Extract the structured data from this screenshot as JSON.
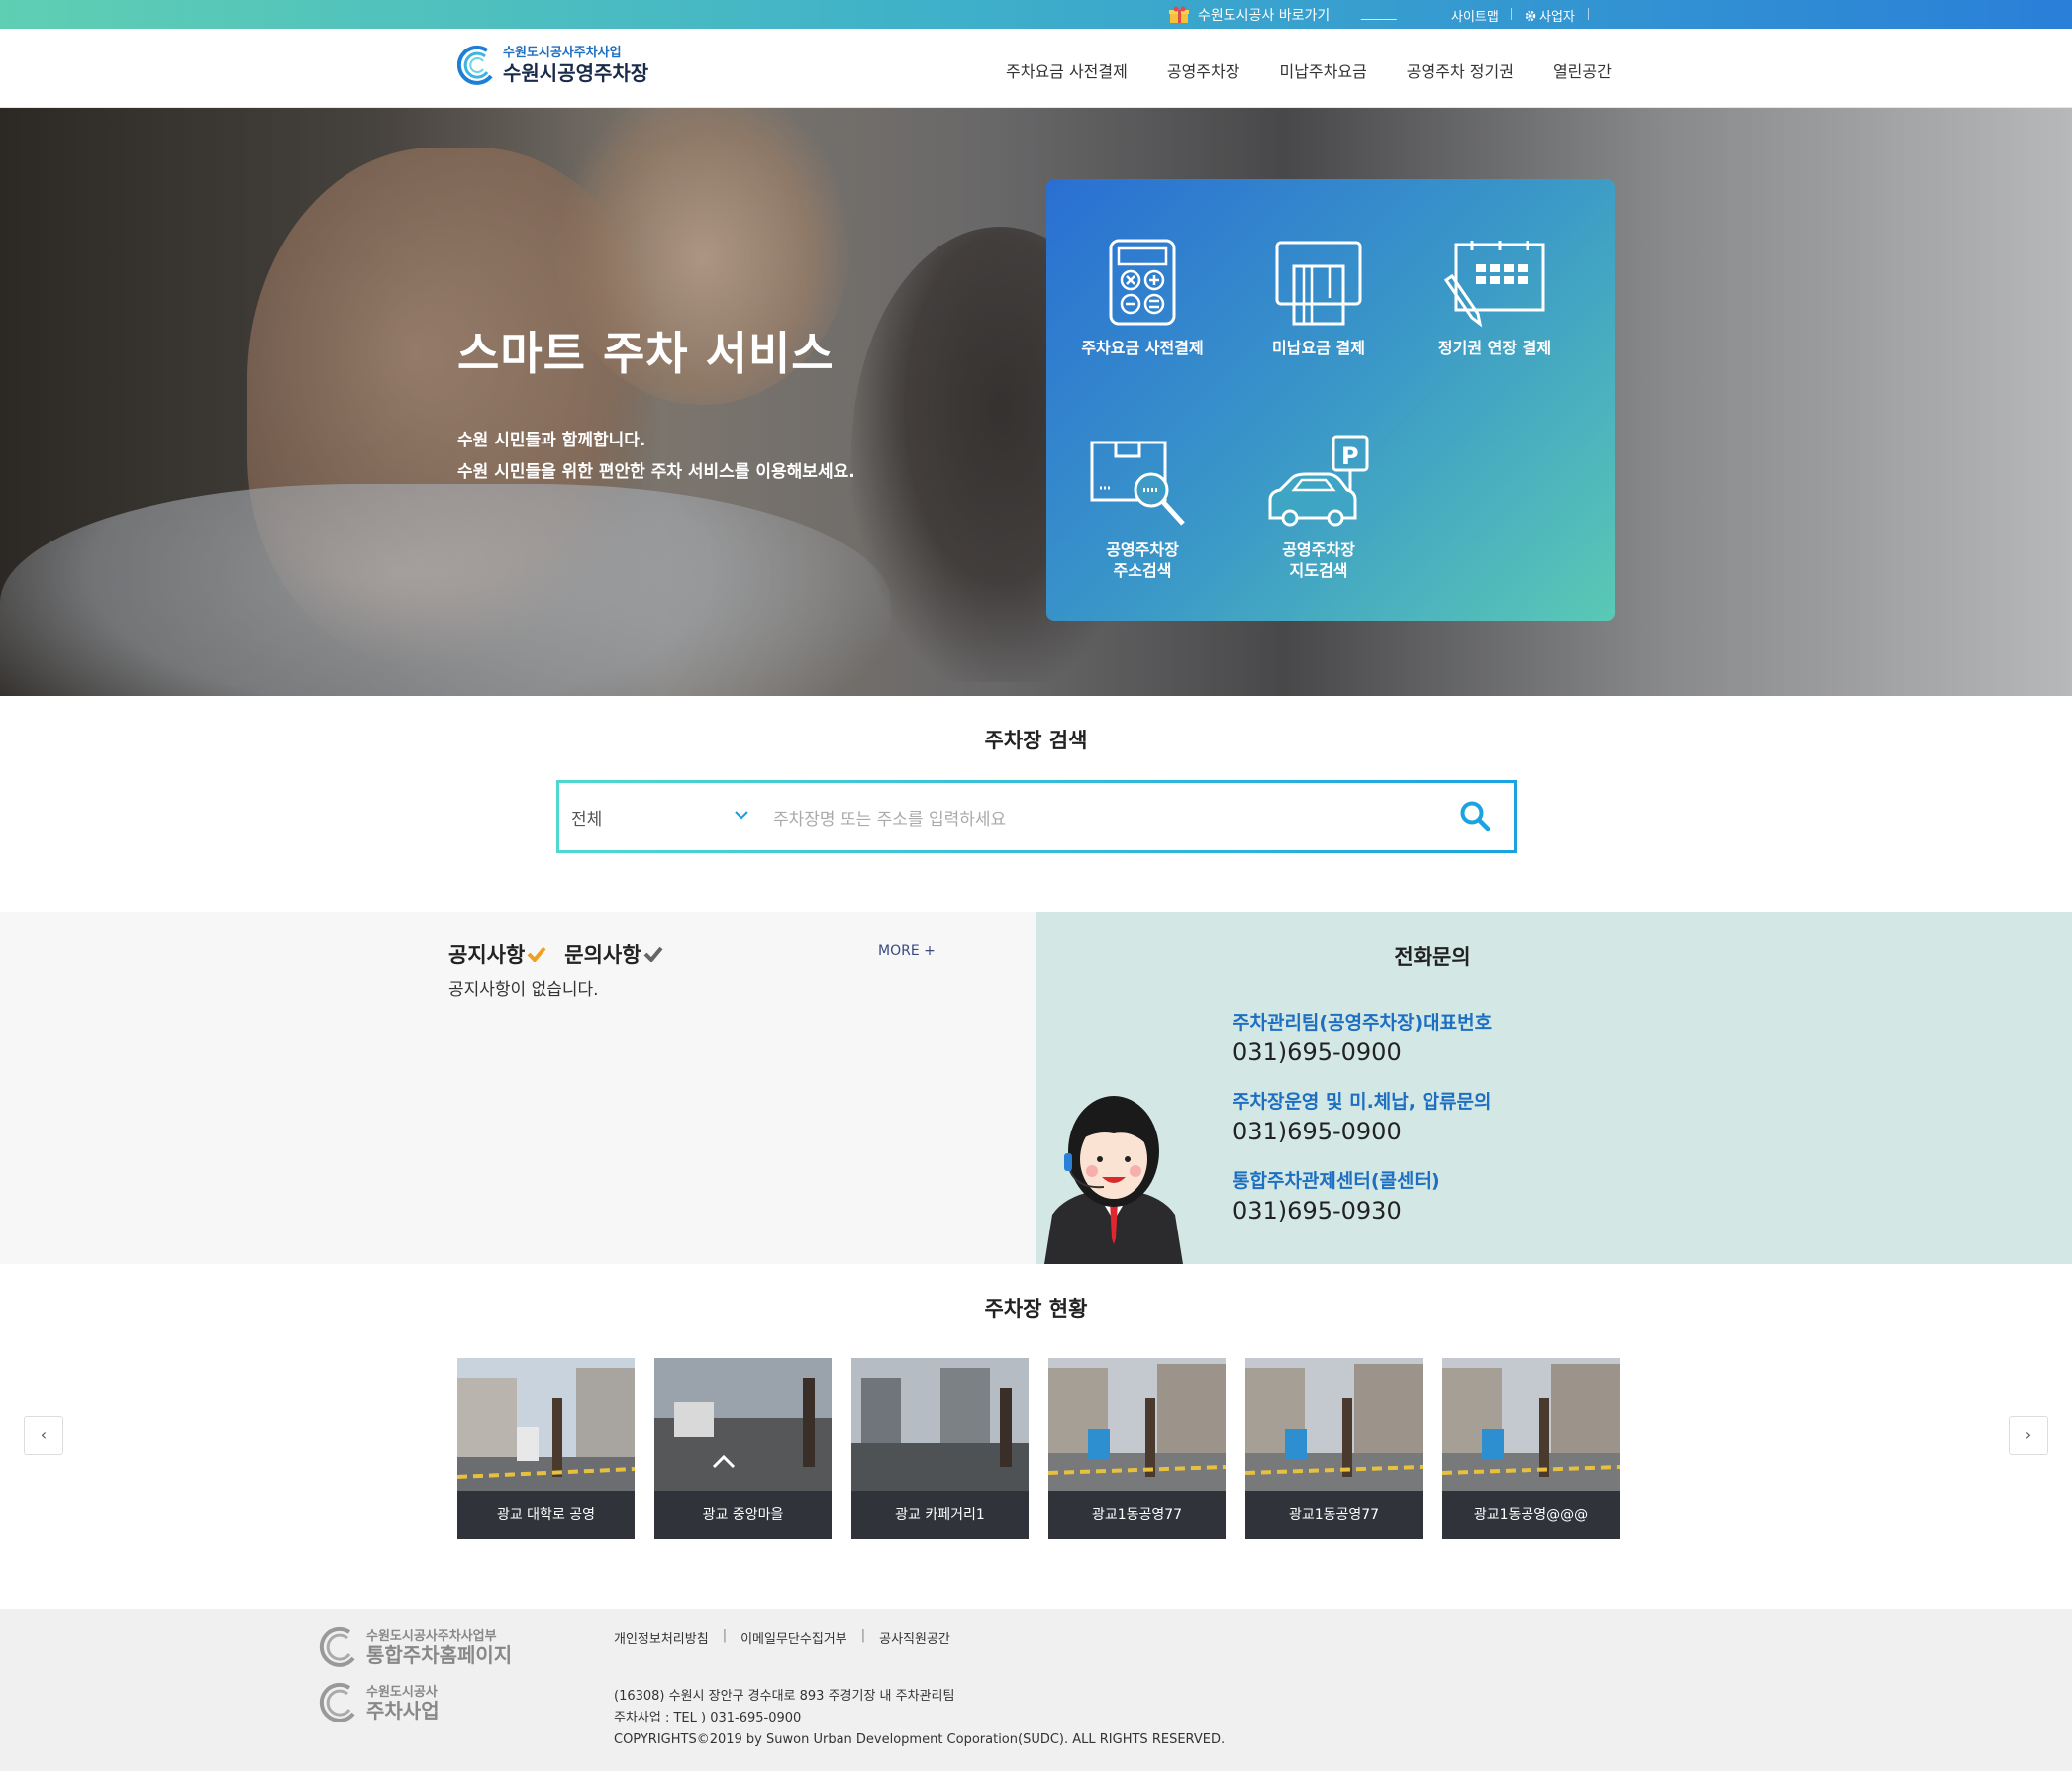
{
  "topbar": {
    "corp_link": "수원도시공사 바로가기",
    "sitemap": "사이트맵",
    "business": "사업자"
  },
  "header": {
    "logo_sub": "수원도시공사주차사업",
    "logo_main": "수원시공영주차장",
    "nav": [
      "주차요금 사전결제",
      "공영주차장",
      "미납주차요금",
      "공영주차 정기권",
      "열린공간"
    ]
  },
  "hero": {
    "title": "스마트 주차 서비스",
    "line1": "수원 시민들과 함께합니다.",
    "line2": "수원 시민들을 위한 편안한 주차 서비스를 이용해보세요.",
    "services": [
      {
        "label": "주차요금 사전결제",
        "icon": "calculator-icon"
      },
      {
        "label": "미납요금 결제",
        "icon": "card-payment-icon"
      },
      {
        "label": "정기권 연장 결제",
        "icon": "calendar-pen-icon"
      },
      {
        "label_line1": "공영주차장",
        "label_line2": "주소검색",
        "icon": "address-search-icon"
      },
      {
        "label_line1": "공영주차장",
        "label_line2": "지도검색",
        "icon": "car-parking-map-icon"
      }
    ]
  },
  "search": {
    "title": "주차장 검색",
    "select_value": "전체",
    "placeholder": "주차장명 또는 주소를 입력하세요"
  },
  "notice": {
    "tab1": "공지사항",
    "tab2": "문의사항",
    "more": "MORE +",
    "empty": "공지사항이 없습니다."
  },
  "phone": {
    "title": "전화문의",
    "entries": [
      {
        "label": "주차관리팀(공영주차장)대표번호",
        "number": "031)695-0900"
      },
      {
        "label": "주차장운영 및 미.체납, 압류문의",
        "number": "031)695-0900"
      },
      {
        "label": "통합주차관제센터(콜센터)",
        "number": "031)695-0930"
      }
    ]
  },
  "status": {
    "title": "주차장 현황",
    "prev": "‹",
    "next": "›",
    "lots": [
      "광교 대학로 공영",
      "광교 중앙마을",
      "광교 카페거리1",
      "광교1동공영77",
      "광교1동공영77",
      "광교1동공영@@@"
    ]
  },
  "footer": {
    "logo1_sub": "수원도시공사주차사업부",
    "logo1_main": "통합주차홈페이지",
    "logo2_sub": "수원도시공사",
    "logo2_main": "주차사업",
    "links": [
      "개인정보처리방침",
      "이메일무단수집거부",
      "공사직원공간"
    ],
    "address": "(16308) 수원시 장안구 경수대로 893 주경기장 내 주차관리팀",
    "tel": "주차사업 : TEL ) 031-695-0900",
    "copyright": "COPYRIGHTS©2019 by Suwon Urban Development Coporation(SUDC). ALL RIGHTS RESERVED."
  }
}
